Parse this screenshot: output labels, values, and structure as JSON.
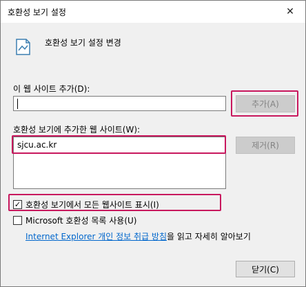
{
  "window": {
    "title": "호환성 보기 설정",
    "close_glyph": "✕"
  },
  "header": {
    "icon": "document-settings-icon",
    "text": "호환성 보기 설정 변경"
  },
  "add_site": {
    "label": "이 웹 사이트 추가(D):",
    "input_value": "",
    "add_button_label": "추가(A)"
  },
  "site_list": {
    "label": "호환성 보기에 추가한 웹 사이트(W):",
    "items": [
      "sjcu.ac.kr"
    ],
    "remove_button_label": "제거(R)"
  },
  "options": {
    "show_all_label": "호환성 보기에서  모든 웹사이트 표시(I)",
    "show_all_checked": true,
    "ms_list_label": "Microsoft 호환성 목록 사용(U)",
    "ms_list_checked": false
  },
  "privacy": {
    "link_text": "Internet Explorer 개인 정보 취급 방침",
    "suffix_text": "을 읽고 자세히 알아보기"
  },
  "footer": {
    "close_button_label": "닫기(C)"
  },
  "colors": {
    "highlight": "#c8175d",
    "link": "#0066cc"
  }
}
